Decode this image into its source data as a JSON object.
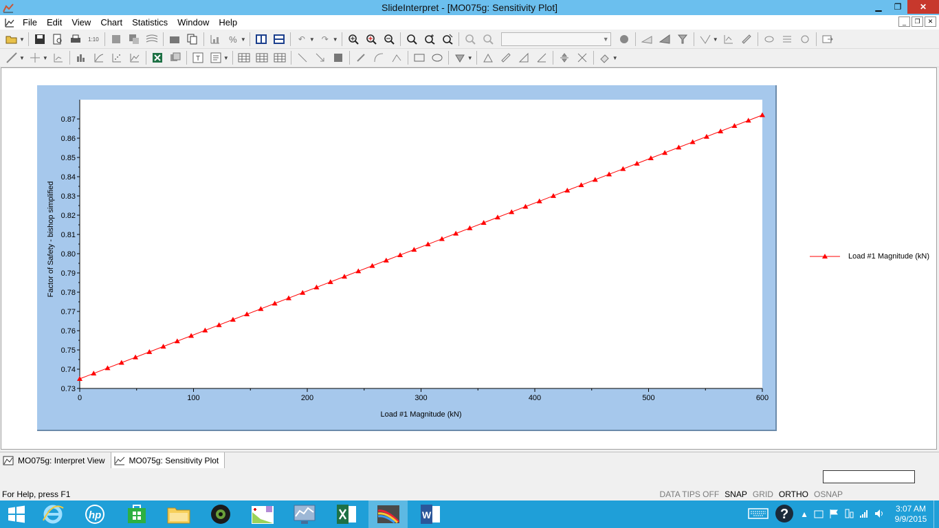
{
  "window": {
    "title": "SlideInterpret - [MO075g: Sensitivity Plot]"
  },
  "menu": [
    "File",
    "Edit",
    "View",
    "Chart",
    "Statistics",
    "Window",
    "Help"
  ],
  "toolbar": {
    "scale_label": "1:10",
    "combo_value": ""
  },
  "chart_data": {
    "type": "line",
    "xlabel": "Load #1 Magnitude (kN)",
    "ylabel": "Factor of Safety - bishop simplified",
    "xlim": [
      0,
      600
    ],
    "ylim": [
      0.73,
      0.88
    ],
    "xticks": [
      0,
      100,
      200,
      300,
      400,
      500,
      600
    ],
    "yticks": [
      0.73,
      0.74,
      0.75,
      0.76,
      0.77,
      0.78,
      0.79,
      0.8,
      0.81,
      0.82,
      0.83,
      0.84,
      0.85,
      0.86,
      0.87
    ],
    "ytick_labels": [
      "0.73",
      "0.74",
      "0.75",
      "0.76",
      "0.77",
      "0.78",
      "0.79",
      "0.80",
      "0.81",
      "0.82",
      "0.83",
      "0.84",
      "0.85",
      "0.86",
      "0.87"
    ],
    "series": [
      {
        "name": "Load #1 Magnitude (kN)",
        "color": "#ff0000",
        "marker": "triangle",
        "x_start": 0,
        "x_end": 600,
        "points": 50,
        "y_start": 0.735,
        "y_end": 0.872
      }
    ],
    "legend": "right",
    "grid": false
  },
  "tabs": [
    {
      "label": "MO075g: Interpret View",
      "active": false
    },
    {
      "label": "MO075g: Sensitivity Plot",
      "active": true
    }
  ],
  "status": {
    "help": "For Help, press F1",
    "modes": [
      {
        "label": "DATA TIPS OFF",
        "on": false
      },
      {
        "label": "SNAP",
        "on": true
      },
      {
        "label": "GRID",
        "on": false
      },
      {
        "label": "ORTHO",
        "on": true
      },
      {
        "label": "OSNAP",
        "on": false
      }
    ]
  },
  "taskbar": {
    "apps": [
      "internet-explorer",
      "hp",
      "store",
      "file-explorer",
      "webcam",
      "slide",
      "performance",
      "excel",
      "slide-interpret",
      "word"
    ],
    "active_app": "slide-interpret",
    "clock_time": "3:07 AM",
    "clock_date": "9/9/2015"
  }
}
